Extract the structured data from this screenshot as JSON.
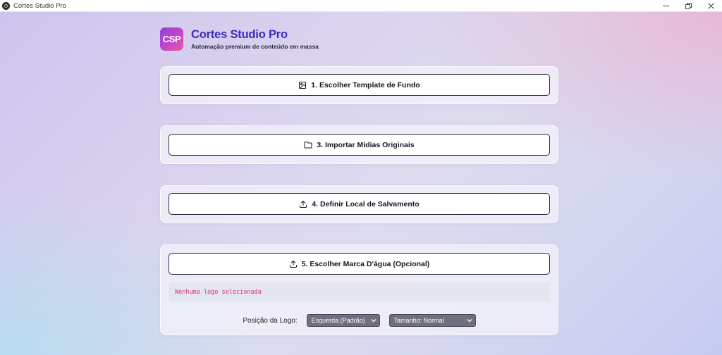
{
  "window": {
    "title": "Cortes Studio Pro",
    "icons": {
      "app": "app-icon",
      "minimize": "minimize-icon",
      "restore": "restore-icon",
      "close": "close-icon"
    }
  },
  "header": {
    "logo_text": "CSP",
    "title": "Cortes Studio Pro",
    "subtitle": "Automação premium de conteúdo em massa"
  },
  "steps": [
    {
      "label": "1. Escolher Template de Fundo",
      "icon": "image-icon"
    },
    {
      "label": "3. Importar Mídias Originais",
      "icon": "folder-icon"
    },
    {
      "label": "4. Definir Local de Salvamento",
      "icon": "upload-icon"
    },
    {
      "label": "5. Escolher Marca D'água (Opcional)",
      "icon": "upload-icon"
    }
  ],
  "watermark": {
    "status_text": "Nenhuma logo selecionada",
    "position_label": "Posição da Logo:",
    "position_selected": "Esquerda (Padrão)",
    "size_selected": "Tamanho: Normal"
  },
  "colors": {
    "accent_title": "#3b2bbf",
    "logo_gradient_start": "#8a43d8",
    "logo_gradient_end": "#e75aa4",
    "status_text": "#e0307a",
    "select_bg": "#6f6f80"
  }
}
